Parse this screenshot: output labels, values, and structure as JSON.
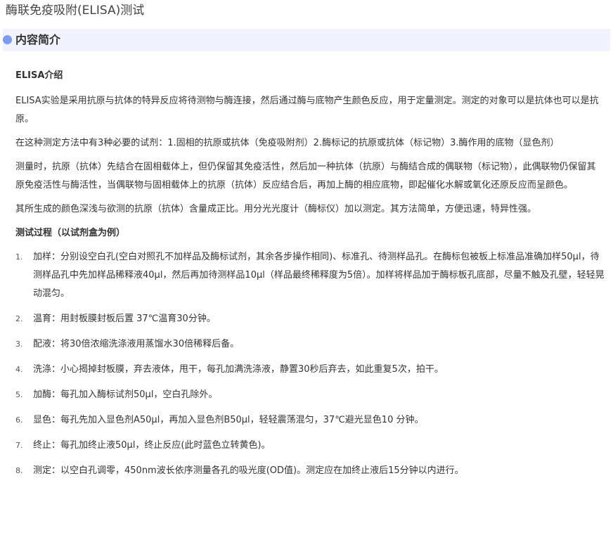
{
  "page": {
    "title": "酶联免疫吸附(ELISA)测试"
  },
  "section": {
    "title": "内容简介"
  },
  "intro": {
    "heading": "ELISA介绍",
    "paragraphs": [
      "ELISA实验是采用抗原与抗体的特异反应将待测物与酶连接，然后通过酶与底物产生颜色反应，用于定量测定。测定的对象可以是抗体也可以是抗原。",
      "在这种测定方法中有3种必要的试剂：1.固相的抗原或抗体（免疫吸附剂）2.酶标记的抗原或抗体（标记物）3.酶作用的底物（显色剂）",
      "测量时，抗原（抗体）先结合在固相载体上，但仍保留其免疫活性，然后加一种抗体（抗原）与酶结合成的偶联物（标记物），此偶联物仍保留其原免疫活性与酶活性，当偶联物与固相载体上的抗原（抗体）反应结合后，再加上酶的相应底物，即起催化水解或氧化还原反应而呈颜色。",
      "其所生成的颜色深浅与欲测的抗原（抗体）含量成正比。用分光光度计（酶标仪）加以测定。其方法简单，方便迅速，特异性强。"
    ]
  },
  "procedure": {
    "heading": "测试过程（以试剂盒为例）",
    "steps": [
      {
        "num": "1.",
        "text": "加样：分别设空白孔(空白对照孔不加样品及酶标试剂，其余各步操作相同)、标准孔、待测样品孔。在酶标包被板上标准品准确加样50μl，待测样品孔中先加样品稀释液40μl，然后再加待测样品10μl（样品最终稀释度为5倍）。加样将样品加于酶标板孔底部，尽量不触及孔壁，轻轻晃动混匀。"
      },
      {
        "num": "2.",
        "text": "温育：用封板膜封板后置 37℃温育30分钟。"
      },
      {
        "num": "3.",
        "text": "配液：将30倍浓缩洗涤液用蒸馏水30倍稀释后备。"
      },
      {
        "num": "4.",
        "text": "洗涤：小心揭掉封板膜，弃去液体，甩干，每孔加满洗涤液，静置30秒后弃去，如此重复5次，拍干。"
      },
      {
        "num": "5.",
        "text": "加酶：每孔加入酶标试剂50μl，空白孔除外。"
      },
      {
        "num": "6.",
        "text": "显色：每孔先加入显色剂A50μl，再加入显色剂B50μl，轻轻震荡混匀，37℃避光显色10 分钟。"
      },
      {
        "num": "7.",
        "text": "终止：每孔加终止液50μl，终止反应(此时蓝色立转黄色)。"
      },
      {
        "num": "8.",
        "text": "测定：以空白孔调零，450nm波长依序测量各孔的吸光度(OD值)。测定应在加终止液后15分钟以内进行。"
      }
    ]
  },
  "colors": {
    "section_bar_bg": "#f0f3fd",
    "bullet_dot": "#7e9bf0",
    "text": "#333333"
  }
}
